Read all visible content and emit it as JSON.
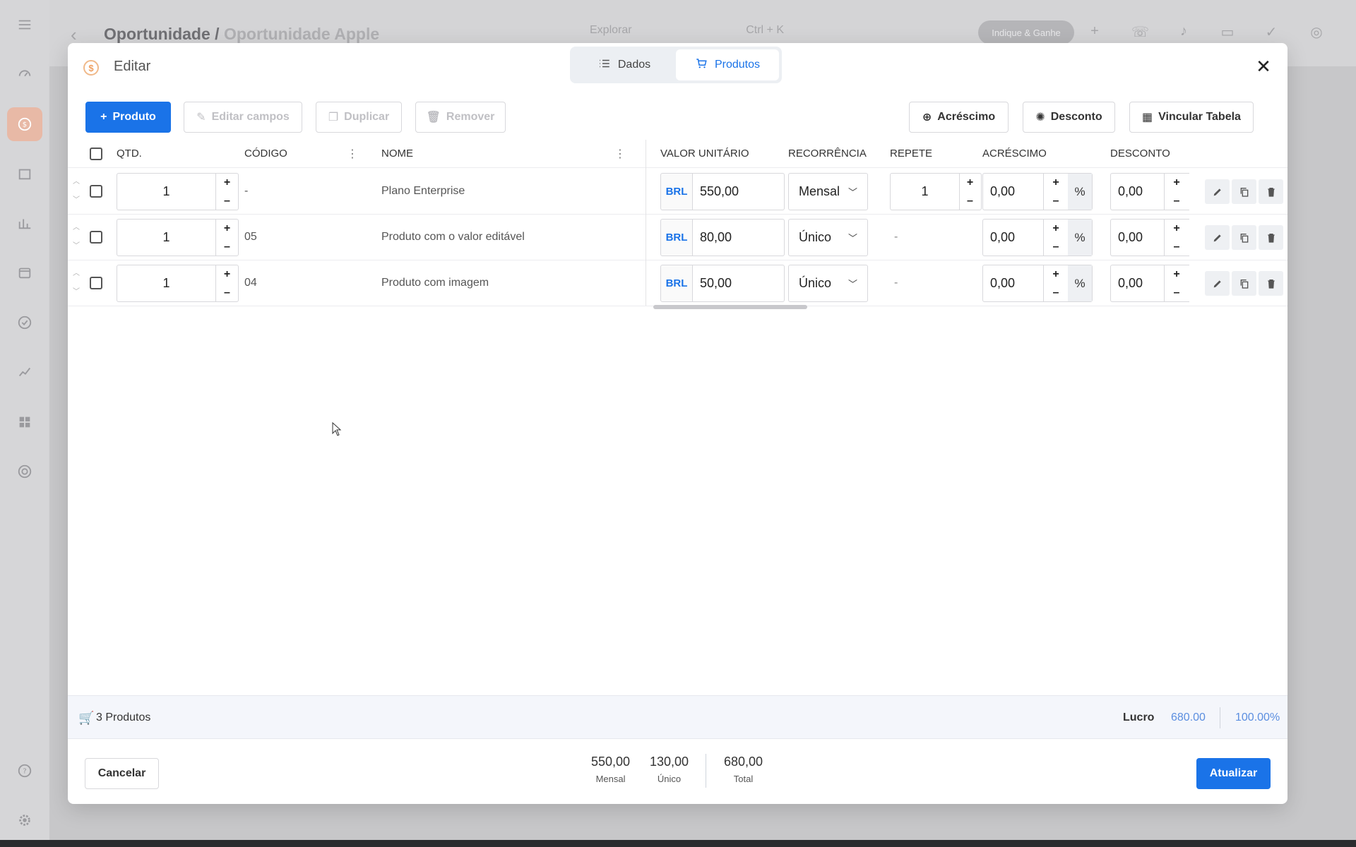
{
  "background": {
    "breadcrumb": {
      "main": "Oportunidade /",
      "sub": "Oportunidade Apple"
    },
    "search": {
      "label": "Explorar",
      "shortcut": "Ctrl + K"
    },
    "indique_button": "Indique & Ganhe"
  },
  "modal": {
    "title": "Editar",
    "tabs": [
      {
        "label": "Dados",
        "icon": "list-icon",
        "active": false
      },
      {
        "label": "Produtos",
        "icon": "cart-icon",
        "active": true
      }
    ],
    "toolbar": {
      "add_product": "Produto",
      "edit_fields": "Editar campos",
      "duplicate": "Duplicar",
      "remove": "Remover",
      "surcharge": "Acréscimo",
      "discount": "Desconto",
      "link_table": "Vincular Tabela"
    },
    "columns": {
      "qty": "QTD.",
      "code": "CÓDIGO",
      "name": "NOME",
      "unit_value": "VALOR UNITÁRIO",
      "recurrence": "RECORRÊNCIA",
      "repeat": "REPETE",
      "surcharge": "ACRÉSCIMO",
      "discount": "DESCONTO"
    },
    "rows": [
      {
        "qty": "1",
        "code": "-",
        "name": "Plano Enterprise",
        "currency": "BRL",
        "price": "550,00",
        "recurrence": "Mensal",
        "repeat": "1",
        "surcharge": "0,00",
        "surcharge_unit": "%",
        "discount": "0,00"
      },
      {
        "qty": "1",
        "code": "05",
        "name": "Produto com o valor editável",
        "currency": "BRL",
        "price": "80,00",
        "recurrence": "Único",
        "repeat": "-",
        "surcharge": "0,00",
        "surcharge_unit": "%",
        "discount": "0,00"
      },
      {
        "qty": "1",
        "code": "04",
        "name": "Produto com imagem",
        "currency": "BRL",
        "price": "50,00",
        "recurrence": "Único",
        "repeat": "-",
        "surcharge": "0,00",
        "surcharge_unit": "%",
        "discount": "0,00"
      }
    ],
    "summary": {
      "count": "3 Produtos",
      "profit_label": "Lucro",
      "profit_value": "680.00",
      "profit_pct": "100.00%"
    },
    "totals": [
      {
        "value": "550,00",
        "label": "Mensal"
      },
      {
        "value": "130,00",
        "label": "Único"
      },
      {
        "value": "680,00",
        "label": "Total"
      }
    ],
    "cancel": "Cancelar",
    "update": "Atualizar"
  },
  "colors": {
    "accent": "#1a73e8",
    "profit": "#5b8ee0"
  }
}
